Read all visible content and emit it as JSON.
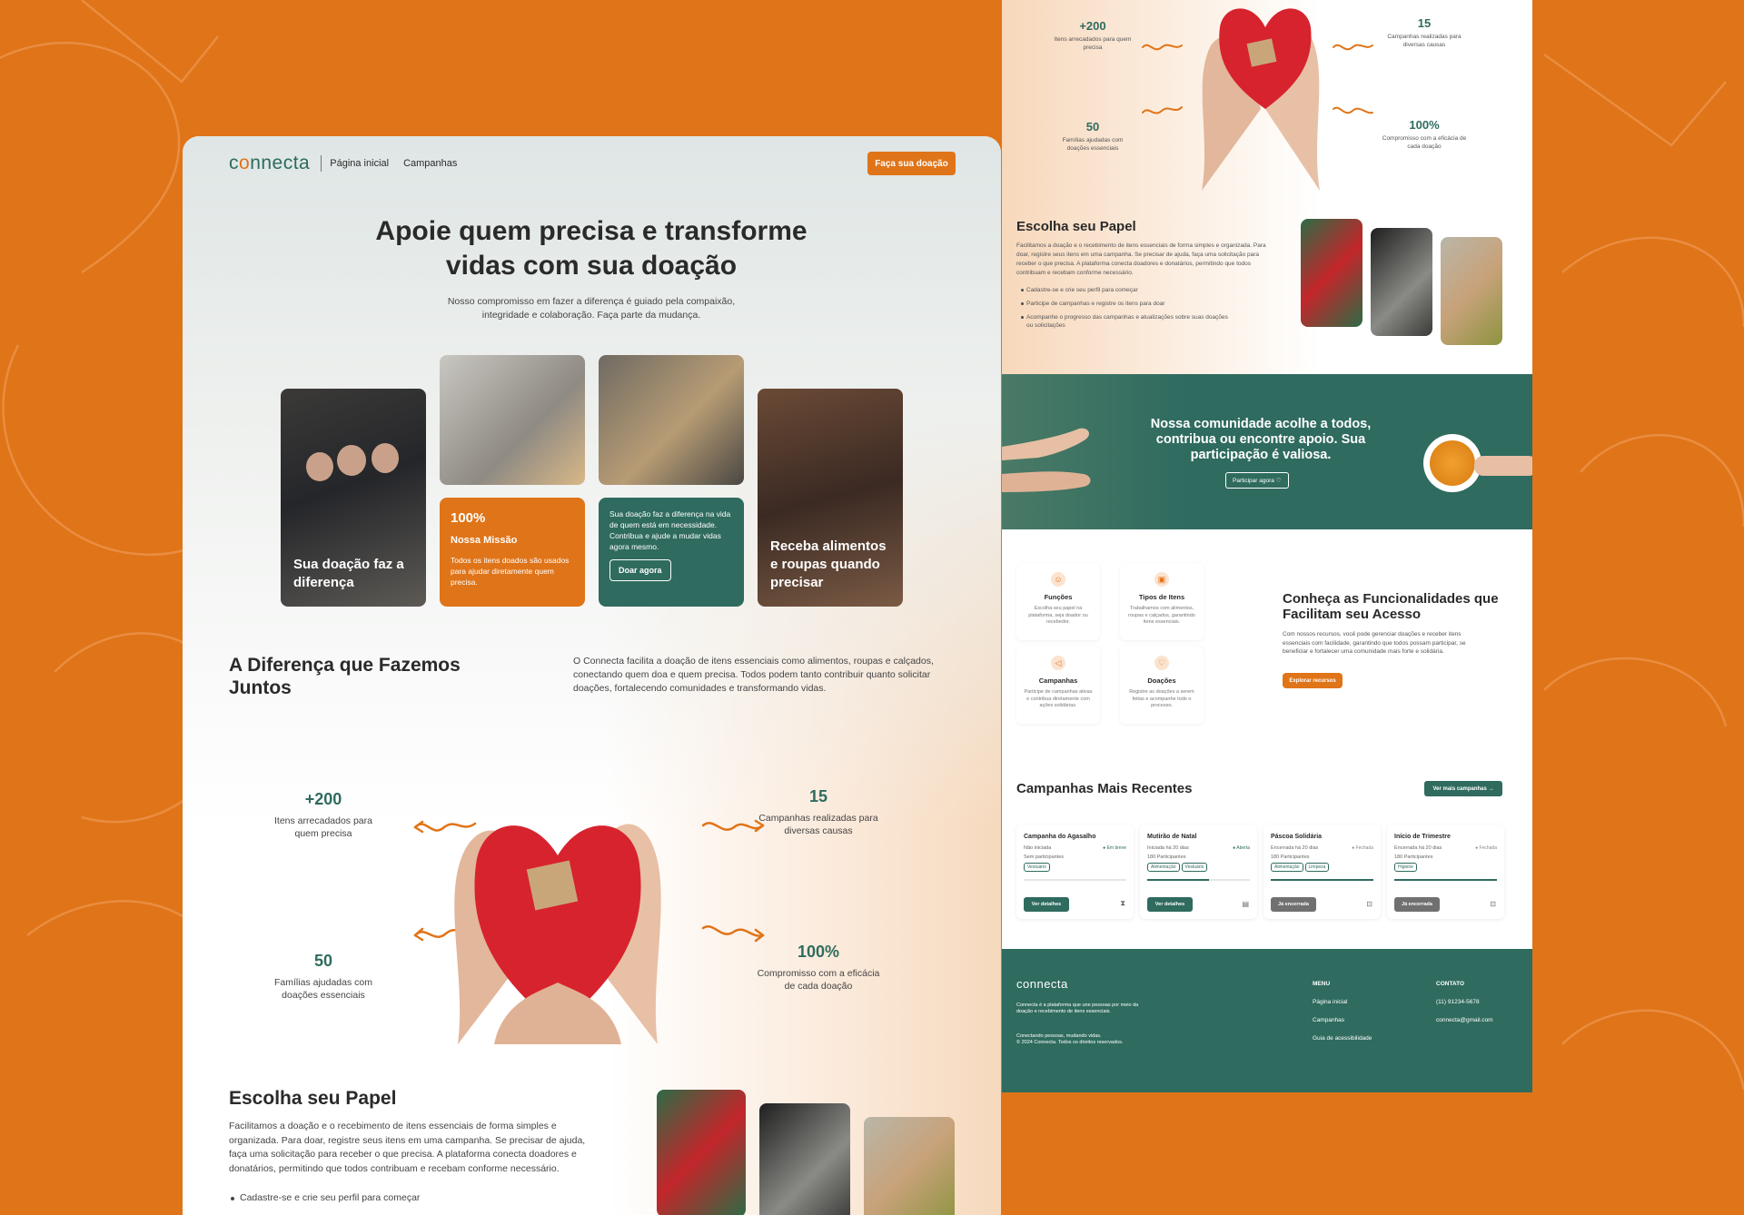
{
  "colors": {
    "accent": "#e07418",
    "primary": "#2f6b5f",
    "background": "#e07418"
  },
  "nav": {
    "logo": "connecta",
    "links": [
      "Página inicial",
      "Campanhas"
    ],
    "cta": "Faça sua doação"
  },
  "hero": {
    "title_line1": "Apoie quem precisa e transforme",
    "title_line2": "vidas com sua doação",
    "subtitle": "Nosso compromisso em fazer a diferença é guiado pela compaixão, integridade e colaboração. Faça parte da mudança."
  },
  "cards": {
    "card1_text": "Sua doação faz a diferença",
    "mission_stat": "100%",
    "mission_title": "Nossa Missão",
    "mission_text": "Todos os itens doados são usados para ajudar diretamente quem precisa.",
    "green_text": "Sua doação faz a diferença na vida de quem está em necessidade. Contribua e ajude a mudar vidas agora mesmo.",
    "green_button": "Doar agora",
    "card4_text": "Receba alimentos e roupas quando precisar"
  },
  "difference": {
    "title": "A Diferença que Fazemos Juntos",
    "text": "O Connecta facilita a doação de itens essenciais como alimentos, roupas e calçados, conectando quem doa e quem precisa. Todos podem tanto contribuir quanto solicitar doações, fortalecendo comunidades e transformando vidas."
  },
  "stats": [
    {
      "value": "+200",
      "label": "Itens arrecadados para quem precisa"
    },
    {
      "value": "15",
      "label": "Campanhas realizadas para diversas causas"
    },
    {
      "value": "50",
      "label": "Famílias ajudadas com doações essenciais"
    },
    {
      "value": "100%",
      "label": "Compromisso com a eficácia de cada doação"
    }
  ],
  "role": {
    "title": "Escolha seu Papel",
    "text": "Facilitamos a doação e o recebimento de itens essenciais de forma simples e organizada. Para doar, registre seus itens em uma campanha. Se precisar de ajuda, faça uma solicitação para receber o que precisa. A plataforma conecta doadores e donatários, permitindo que todos contribuam e recebam conforme necessário.",
    "bullets": [
      "Cadastre-se e crie seu perfil para começar",
      "Participe de campanhas e registre os itens para doar",
      "Acompanhe o progresso das campanhas e atualizações sobre suas doações ou solicitações"
    ]
  },
  "community": {
    "text": "Nossa comunidade acolhe a todos, contribua ou encontre apoio. Sua participação é valiosa.",
    "button": "Participar agora"
  },
  "features": {
    "items": [
      {
        "icon": "user-icon",
        "title": "Funções",
        "text": "Escolha seu papel na plataforma, seja doador ou recebedor."
      },
      {
        "icon": "box-icon",
        "title": "Tipos de Itens",
        "text": "Trabalhamos com alimentos, roupas e calçados, garantindo itens essenciais."
      },
      {
        "icon": "megaphone-icon",
        "title": "Campanhas",
        "text": "Participe de campanhas ativas e contribua diretamente com ações solidárias."
      },
      {
        "icon": "heart-hand-icon",
        "title": "Doações",
        "text": "Registre as doações a serem feitas e acompanhe todo o processo."
      }
    ],
    "title": "Conheça as Funcionalidades que Facilitam seu Acesso",
    "text": "Com nossos recursos, você pode gerenciar doações e receber itens essenciais com facilidade, garantindo que todos possam participar, se beneficiar e fortalecer uma comunidade mais forte e solidária.",
    "button": "Explorar recursos"
  },
  "campaigns": {
    "title": "Campanhas Mais Recentes",
    "more": "Ver mais campanhas",
    "items": [
      {
        "name": "Campanha do Agasalho",
        "date": "Não iniciada",
        "status": "Em breve",
        "participants": "Sem participantes",
        "tags": [
          "Vestuário"
        ],
        "button": "Ver detalhes",
        "progress": 0,
        "active": true
      },
      {
        "name": "Mutirão de Natal",
        "date": "Iniciada há 20 dias",
        "status": "Aberta",
        "participants": "180 Participantes",
        "tags": [
          "Alimentação",
          "Vestuário"
        ],
        "button": "Ver detalhes",
        "progress": 0.6,
        "active": true
      },
      {
        "name": "Páscoa Solidária",
        "date": "Encerrada há 20 dias",
        "status": "Fechada",
        "participants": "180 Participantes",
        "tags": [
          "Alimentação",
          "Limpeza"
        ],
        "button": "Já encerrada",
        "progress": 1,
        "active": false
      },
      {
        "name": "Início de Trimestre",
        "date": "Encerrada há 20 dias",
        "status": "Fechada",
        "participants": "180 Participantes",
        "tags": [
          "Higiene"
        ],
        "button": "Já encerrada",
        "progress": 1,
        "active": false
      }
    ]
  },
  "footer": {
    "logo": "connecta",
    "description": "Connecta é a plataforma que une pessoas por meio da doação e recebimento de itens essenciais.",
    "tagline": "Conectando pessoas, mudando vidas.",
    "copyright": "© 2024 Connecta. Todos os direitos reservados.",
    "menu_title": "MENU",
    "menu": [
      "Página inicial",
      "Campanhas",
      "Guia de acessibilidade"
    ],
    "contact_title": "CONTATO",
    "contact": [
      "(11) 91234-5678",
      "connecta@gmail.com"
    ]
  }
}
